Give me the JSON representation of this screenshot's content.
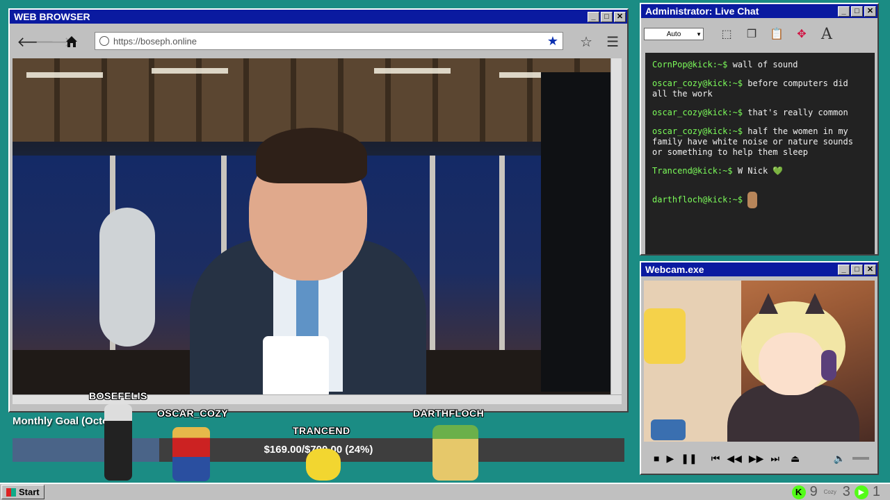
{
  "browser": {
    "title": "WEB BROWSER",
    "url": "https://boseph.online",
    "back_icon": "arrow-left-icon",
    "forward_icon": "arrow-right-icon",
    "home_icon": "home-icon"
  },
  "chat": {
    "title": "Administrator: Live Chat",
    "font_select": "Auto",
    "messages": [
      {
        "user": "CornPop@kick:~$",
        "text": "wall of sound"
      },
      {
        "user": "oscar_cozy@kick:~$",
        "text": "before computers did all the work"
      },
      {
        "user": "oscar_cozy@kick:~$",
        "text": "that's really common"
      },
      {
        "user": "oscar_cozy@kick:~$",
        "text": "half the women in my family have white noise or nature sounds or something to help them sleep"
      },
      {
        "user": "Trancend@kick:~$",
        "text": "W Nick 💚"
      },
      {
        "user": "darthfloch@kick:~$",
        "text": ""
      }
    ]
  },
  "webcam": {
    "title": "Webcam.exe"
  },
  "overlay": {
    "usernames": [
      "BOSEFELIS",
      "OSCAR_COZY",
      "TRANCEND",
      "DARTHFLOCH"
    ],
    "goal_label": "Monthly Goal (October)",
    "goal_text": "$169.00/$700.00 (24%)",
    "goal_progress": 0.24
  },
  "taskbar": {
    "start_label": "Start",
    "count_kick": "9",
    "count_cozy": "3",
    "count_other": "1",
    "cozy_label": "Cozy"
  },
  "colors": {
    "desktop": "#1b8c84",
    "titlebar": "#0a1aa0",
    "chat_user": "#7cfc5a",
    "kick_green": "#53fc18"
  }
}
